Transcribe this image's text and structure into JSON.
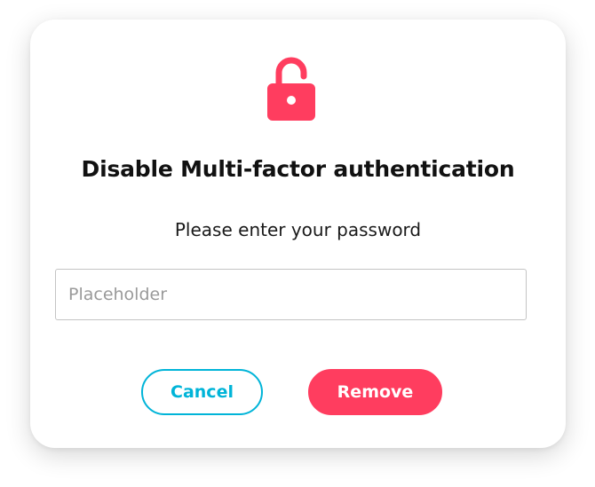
{
  "dialog": {
    "title": "Disable Multi-factor authentication",
    "subtitle": "Please enter your password",
    "icon": "lock-open-icon",
    "password": {
      "value": "",
      "placeholder": "Placeholder"
    },
    "buttons": {
      "cancel_label": "Cancel",
      "remove_label": "Remove"
    }
  },
  "colors": {
    "accent_danger": "#ff3d5f",
    "accent_cancel": "#00b4d8",
    "title_text": "#111111",
    "input_border": "#c4c4c4"
  }
}
